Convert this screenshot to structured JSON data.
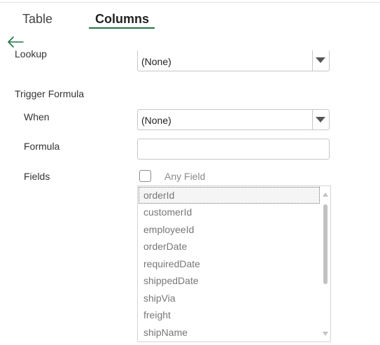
{
  "tabs": {
    "table_label": "Table",
    "columns_label": "Columns",
    "active": "Columns"
  },
  "nav": {
    "back_icon": "arrow-left-icon",
    "accent_color": "#217346"
  },
  "form": {
    "lookup": {
      "label": "Lookup",
      "value": "(None)"
    },
    "trigger_formula": {
      "heading": "Trigger Formula",
      "when": {
        "label": "When",
        "value": "(None)"
      },
      "formula": {
        "label": "Formula",
        "value": ""
      },
      "fields": {
        "label": "Fields",
        "any_field_label": "Any Field",
        "any_field_checked": false,
        "items": [
          {
            "label": "orderId"
          },
          {
            "label": "customerId"
          },
          {
            "label": "employeeId"
          },
          {
            "label": "orderDate"
          },
          {
            "label": "requiredDate"
          },
          {
            "label": "shippedDate"
          },
          {
            "label": "shipVia"
          },
          {
            "label": "freight"
          },
          {
            "label": "shipName"
          }
        ],
        "focused_item": "orderId"
      }
    }
  }
}
